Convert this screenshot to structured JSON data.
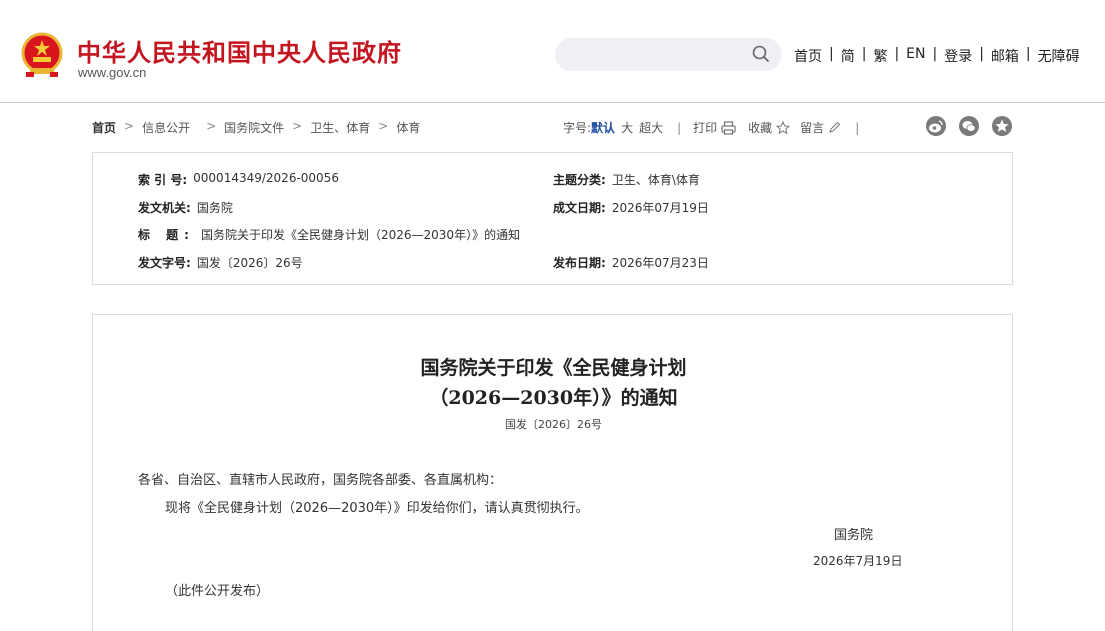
{
  "header": {
    "site_title": "中华人民共和国中央人民政府",
    "site_url": "www.gov.cn",
    "search_placeholder": "",
    "nav": [
      "首页",
      "简",
      "繁",
      "EN",
      "登录",
      "邮箱",
      "无障碍"
    ],
    "nav_separator": "|"
  },
  "breadcrumb": {
    "items": [
      "首页",
      "信息公开",
      "国务院文件",
      "卫生、体育",
      "体育"
    ],
    "separator": ">"
  },
  "toolbar": {
    "font_size_label": "字号:",
    "font_default": "默认",
    "font_large": "大",
    "font_xlarge": "超大",
    "divider": "|",
    "print_label": "打印",
    "favorite_label": "收藏",
    "comment_label": "留言"
  },
  "metadata": {
    "index_label": "索 引 号:",
    "index_value": "000014349/2026-00056",
    "topic_label": "主题分类:",
    "topic_value": "卫生、体育\\体育",
    "issuer_label": "发文机关:",
    "issuer_value": "国务院",
    "written_date_label": "成文日期:",
    "written_date_value": "2026年07月19日",
    "title_label": "标 题:",
    "title_value": "国务院关于印发《全民健身计划（2026—2030年）》的通知",
    "doc_number_label": "发文字号:",
    "doc_number_value": "国发〔2026〕26号",
    "publish_date_label": "发布日期:",
    "publish_date_value": "2026年07月23日"
  },
  "document": {
    "title_line1": "国务院关于印发《全民健身计划",
    "title_line2": "（2026—2030年）》的通知",
    "doc_number": "国发〔2026〕26号",
    "salutation": "各省、自治区、直辖市人民政府，国务院各部委、各直属机构：",
    "body": "现将《全民健身计划（2026—2030年）》印发给你们，请认真贯彻执行。",
    "signer": "国务院",
    "date": "2026年7月19日",
    "note": "（此件公开发布）"
  },
  "colors": {
    "brand_red": "#c3141f",
    "link_blue": "#1c4ea1"
  },
  "icons": [
    "national-emblem-icon",
    "search-icon",
    "print-icon",
    "star-icon",
    "pen-icon",
    "weibo-icon",
    "wechat-icon",
    "qzone-icon"
  ]
}
